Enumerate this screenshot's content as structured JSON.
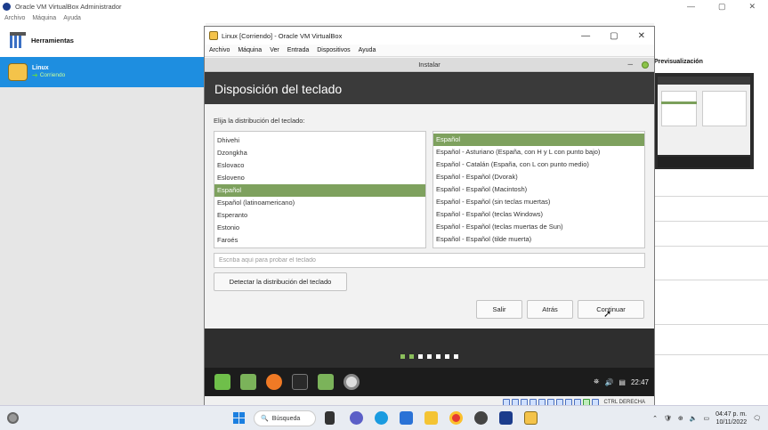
{
  "host": {
    "title": "Oracle VM VirtualBox Administrador",
    "menu": [
      "Archivo",
      "Máquina",
      "Ayuda"
    ],
    "tools_label": "Herramientas",
    "vm_name": "Linux",
    "vm_state": "Corriendo",
    "preview_label": "Previsualización",
    "window_controls": [
      "—",
      "▢",
      "✕"
    ]
  },
  "vm_window": {
    "title": "Linux [Corriendo] - Oracle VM VirtualBox",
    "menu": [
      "Archivo",
      "Máquina",
      "Ver",
      "Entrada",
      "Dispositivos",
      "Ayuda"
    ],
    "controls": [
      "—",
      "▢",
      "✕"
    ],
    "host_key": "CTRL DERECHA"
  },
  "installer": {
    "window_title": "Instalar",
    "heading": "Disposición del teclado",
    "prompt": "Elija la distribución del teclado:",
    "layouts": [
      "Dhivehi",
      "Dzongkha",
      "Eslovaco",
      "Esloveno",
      "Español",
      "Español (latinoamericano)",
      "Esperanto",
      "Estonio",
      "Faroés"
    ],
    "selected_layout": "Español",
    "variants": [
      "Español",
      "Español - Asturiano (España, con H y L con punto bajo)",
      "Español - Catalán (España, con L con punto medio)",
      "Español - Español (Dvorak)",
      "Español - Español (Macintosh)",
      "Español - Español (sin teclas muertas)",
      "Español - Español (teclas Windows)",
      "Español - Español (teclas muertas de Sun)",
      "Español - Español (tilde muerta)"
    ],
    "selected_variant": "Español",
    "test_placeholder": "Escriba aquí para probar el teclado",
    "detect_label": "Detectar la distribución del teclado",
    "quit_label": "Salir",
    "back_label": "Atrás",
    "continue_label": "Continuar",
    "progress_steps_total": 7,
    "progress_steps_done": 2
  },
  "guest_panel": {
    "clock": "22:47"
  },
  "taskbar": {
    "search_label": "Búsqueda",
    "time": "04:47 p. m.",
    "date": "10/11/2022"
  },
  "colors": {
    "accent_green": "#7ea15e",
    "host_selection": "#1e8ee0",
    "installer_dark": "#3a3a3a"
  }
}
